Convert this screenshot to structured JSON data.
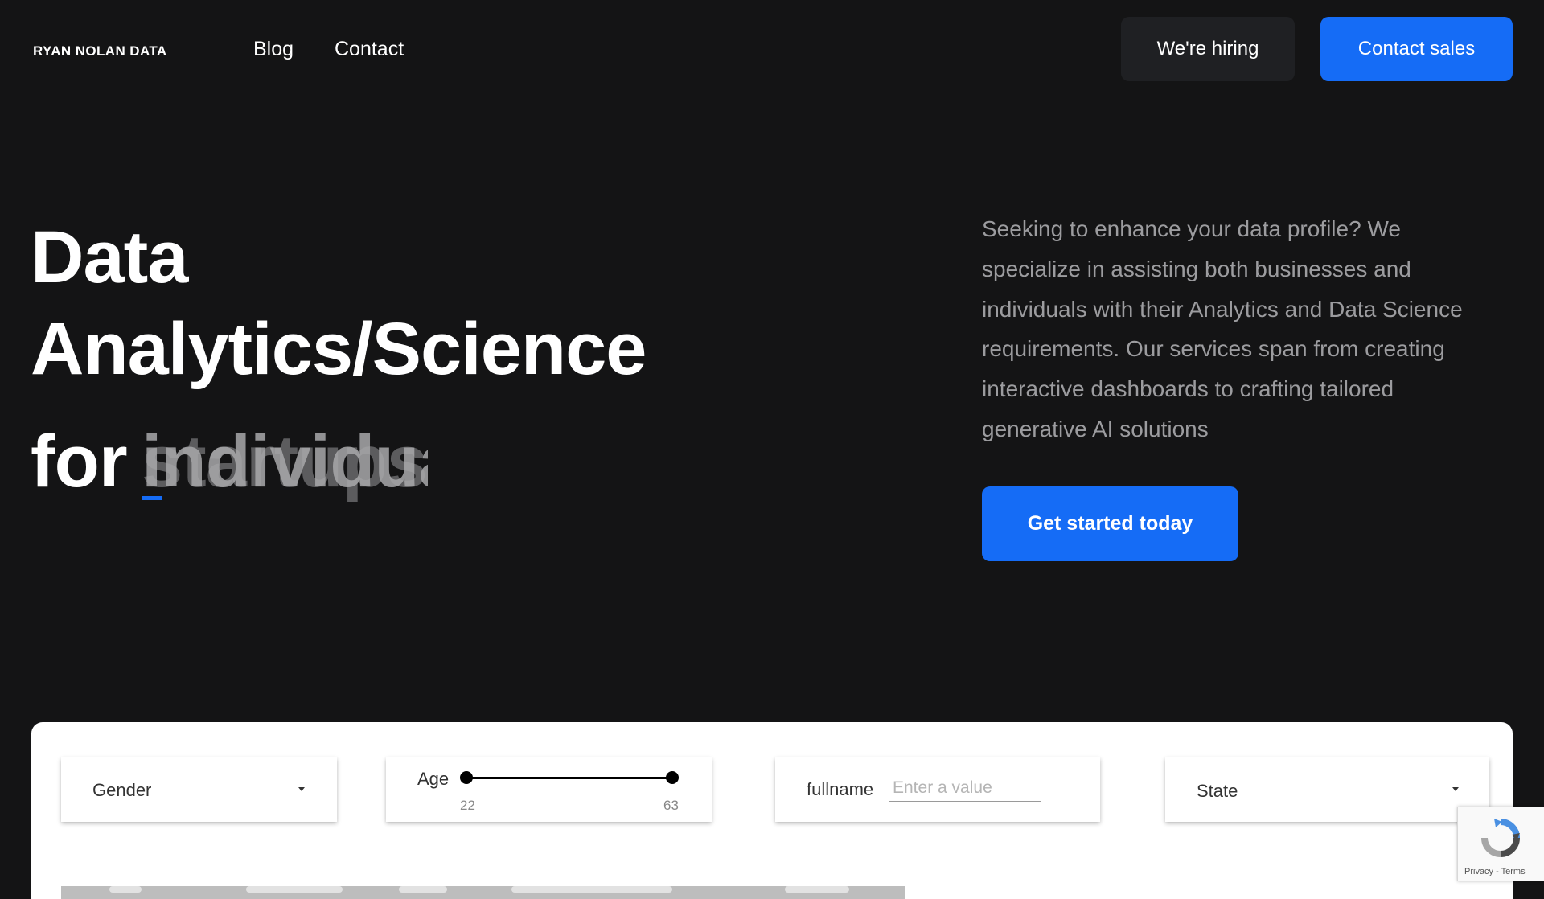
{
  "header": {
    "brand": "RYAN NOLAN DATA",
    "nav": [
      "Blog",
      "Contact"
    ],
    "hiring_button": "We're hiring",
    "sales_button": "Contact sales"
  },
  "hero": {
    "title_line1": "Data",
    "title_line2": "Analytics/Science",
    "for_word": "for",
    "typed_word_back": "startups",
    "typed_word_front": "individua",
    "description": "Seeking to enhance your data profile? We specialize in assisting both businesses and individuals with their Analytics and Data Science requirements. Our services span from creating interactive dashboards to crafting tailored generative AI solutions",
    "cta_button": "Get started today"
  },
  "dashboard": {
    "gender": {
      "label": "Gender"
    },
    "age": {
      "label": "Age",
      "min": "22",
      "max": "63"
    },
    "fullname": {
      "label": "fullname",
      "placeholder": "Enter a value"
    },
    "state": {
      "label": "State"
    }
  },
  "recaptcha": {
    "links": "Privacy - Terms",
    "icon": "recaptcha-icon"
  },
  "colors": {
    "background": "#141415",
    "accent": "#156cf6",
    "dark_button": "#1f2023"
  }
}
